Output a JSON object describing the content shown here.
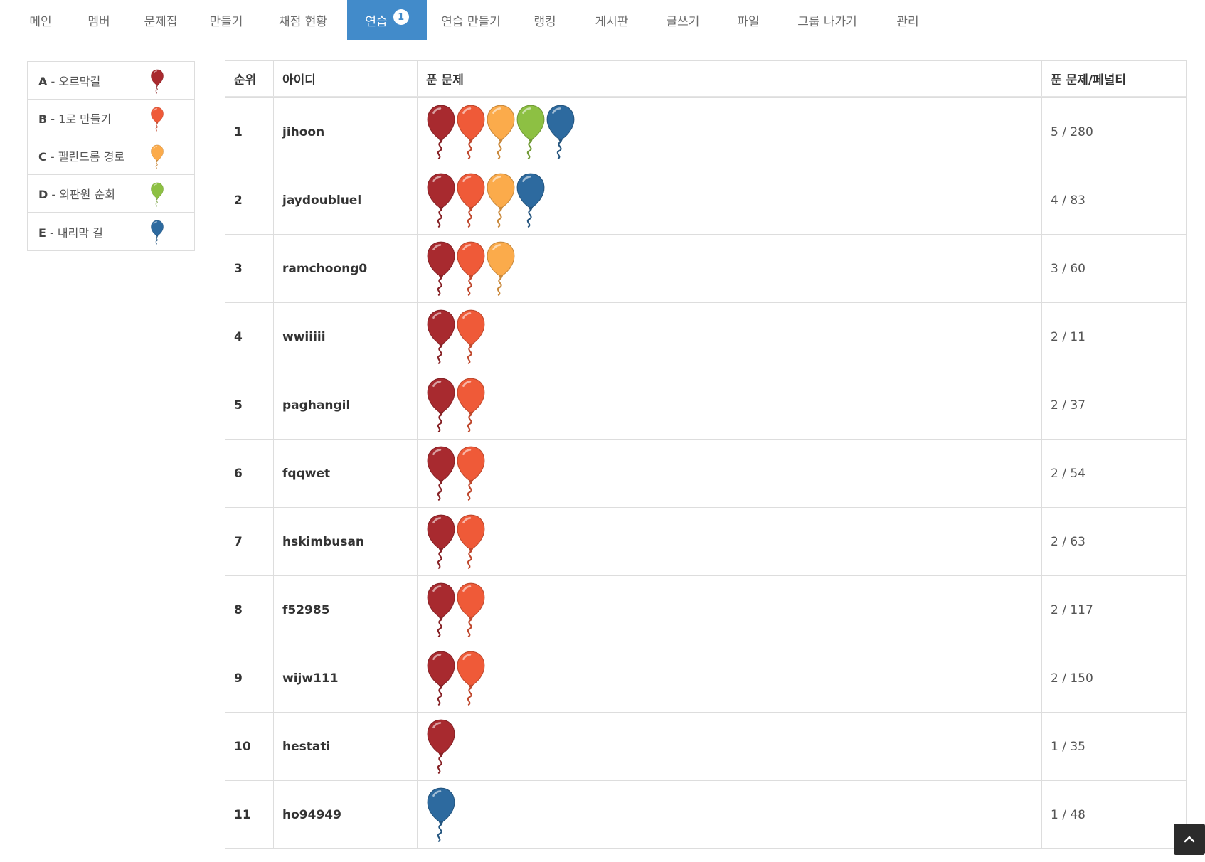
{
  "nav": {
    "items": [
      {
        "label": "메인",
        "active": false
      },
      {
        "label": "멤버",
        "active": false
      },
      {
        "label": "문제집",
        "active": false
      },
      {
        "label": "만들기",
        "active": false
      },
      {
        "label": "채점 현황",
        "active": false
      },
      {
        "label": "연습",
        "active": true,
        "badge": "1"
      },
      {
        "label": "연습 만들기",
        "active": false
      },
      {
        "label": "랭킹",
        "active": false
      },
      {
        "label": "게시판",
        "active": false
      },
      {
        "label": "글쓰기",
        "active": false
      },
      {
        "label": "파일",
        "active": false
      },
      {
        "label": "그룹 나가기",
        "active": false
      },
      {
        "label": "관리",
        "active": false
      }
    ]
  },
  "legend": [
    {
      "letter": "A",
      "sep": " - ",
      "title": "오르막길",
      "color": "#a82a2f"
    },
    {
      "letter": "B",
      "sep": " - ",
      "title": "1로 만들기",
      "color": "#ef5a38"
    },
    {
      "letter": "C",
      "sep": " - ",
      "title": "팰린드롬 경로",
      "color": "#fbab4b"
    },
    {
      "letter": "D",
      "sep": " - ",
      "title": "외판원 순회",
      "color": "#8dc043"
    },
    {
      "letter": "E",
      "sep": " - ",
      "title": "내리막 길",
      "color": "#2d6a9f"
    }
  ],
  "table": {
    "headers": {
      "rank": "순위",
      "id": "아이디",
      "solved": "푼 문제",
      "score": "푼 문제/페널티"
    },
    "rows": [
      {
        "rank": "1",
        "id": "jihoon",
        "balloons": [
          "#a82a2f",
          "#ef5a38",
          "#fbab4b",
          "#8dc043",
          "#2d6a9f"
        ],
        "score": "5 / 280"
      },
      {
        "rank": "2",
        "id": "jaydoubluel",
        "balloons": [
          "#a82a2f",
          "#ef5a38",
          "#fbab4b",
          "#2d6a9f"
        ],
        "score": "4 / 83"
      },
      {
        "rank": "3",
        "id": "ramchoong0",
        "balloons": [
          "#a82a2f",
          "#ef5a38",
          "#fbab4b"
        ],
        "score": "3 / 60"
      },
      {
        "rank": "4",
        "id": "wwiiiii",
        "balloons": [
          "#a82a2f",
          "#ef5a38"
        ],
        "score": "2 / 11"
      },
      {
        "rank": "5",
        "id": "paghangil",
        "balloons": [
          "#a82a2f",
          "#ef5a38"
        ],
        "score": "2 / 37"
      },
      {
        "rank": "6",
        "id": "fqqwet",
        "balloons": [
          "#a82a2f",
          "#ef5a38"
        ],
        "score": "2 / 54"
      },
      {
        "rank": "7",
        "id": "hskimbusan",
        "balloons": [
          "#a82a2f",
          "#ef5a38"
        ],
        "score": "2 / 63"
      },
      {
        "rank": "8",
        "id": "f52985",
        "balloons": [
          "#a82a2f",
          "#ef5a38"
        ],
        "score": "2 / 117"
      },
      {
        "rank": "9",
        "id": "wijw111",
        "balloons": [
          "#a82a2f",
          "#ef5a38"
        ],
        "score": "2 / 150"
      },
      {
        "rank": "10",
        "id": "hestati",
        "balloons": [
          "#a82a2f"
        ],
        "score": "1 / 35"
      },
      {
        "rank": "11",
        "id": "ho94949",
        "balloons": [
          "#2d6a9f"
        ],
        "score": "1 / 48"
      }
    ]
  },
  "scroll_top": {
    "icon": "chevron-up-icon"
  }
}
